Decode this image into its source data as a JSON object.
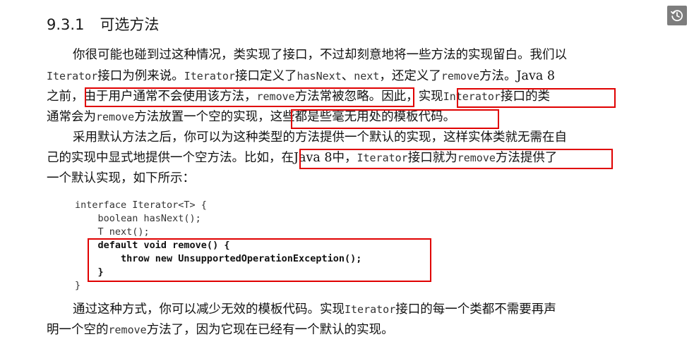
{
  "section": {
    "number": "9.3.1",
    "title": "可选方法"
  },
  "para1": {
    "l1": "你很可能也碰到过这种情况，类实现了接口，不过却刻意地将一些方法的实现留白。我们以",
    "l2a": "Iterator",
    "l2b": "接口为例来说。",
    "l2c": "Iterator",
    "l2d": "接口定义了",
    "l2e": "hasNext",
    "l2f": "、",
    "l2g": "next",
    "l2h": "，还定义了",
    "l2i": "remove",
    "l2j": "方法。Java 8",
    "l3a": "之前，",
    "l3b": "由于用户通常不会使用该方法，",
    "l3c": "remove",
    "l3d": "方法常被忽略。",
    "l3e": "因此，",
    "l3f": "实现",
    "l3g": "Interator",
    "l3h": "接口的类",
    "l4a": "通常会为",
    "l4b": "remove",
    "l4c": "方法放置一个空的实现，",
    "l4d": "这些都是些毫无用处的模板代码。"
  },
  "para2": {
    "l1": "采用默认方法之后，你可以为这种类型的方法提供一个默认的实现，这样实体类就无需在自",
    "l2a": "己的实现中显式地提供一个空方法。比如，",
    "l2b": "在Java 8中，",
    "l2c": "Iterator",
    "l2d": "接口就为",
    "l2e": "remove",
    "l2f": "方法提供了",
    "l3": "一个默认实现，如下所示："
  },
  "code": {
    "line1": "interface Iterator<T> {",
    "line2": "    boolean hasNext();",
    "line3": "    T next();",
    "line4": "    default void remove() {",
    "line5": "        throw new UnsupportedOperationException();",
    "line6": "    }",
    "line7": "}"
  },
  "para3": {
    "l1a": "通过这种方式，你可以减少无效的模板代码。实现",
    "l1b": "Iterator",
    "l1c": "接口的每一个类都不需要再声",
    "l2a": "明一个空的",
    "l2b": "remove",
    "l2c": "方法了，因为它现在已经有一个默认的实现。"
  },
  "toolbar": {
    "history_icon": "history-icon"
  },
  "colors": {
    "highlight": "#e00000",
    "button": "#7d7d7d"
  }
}
